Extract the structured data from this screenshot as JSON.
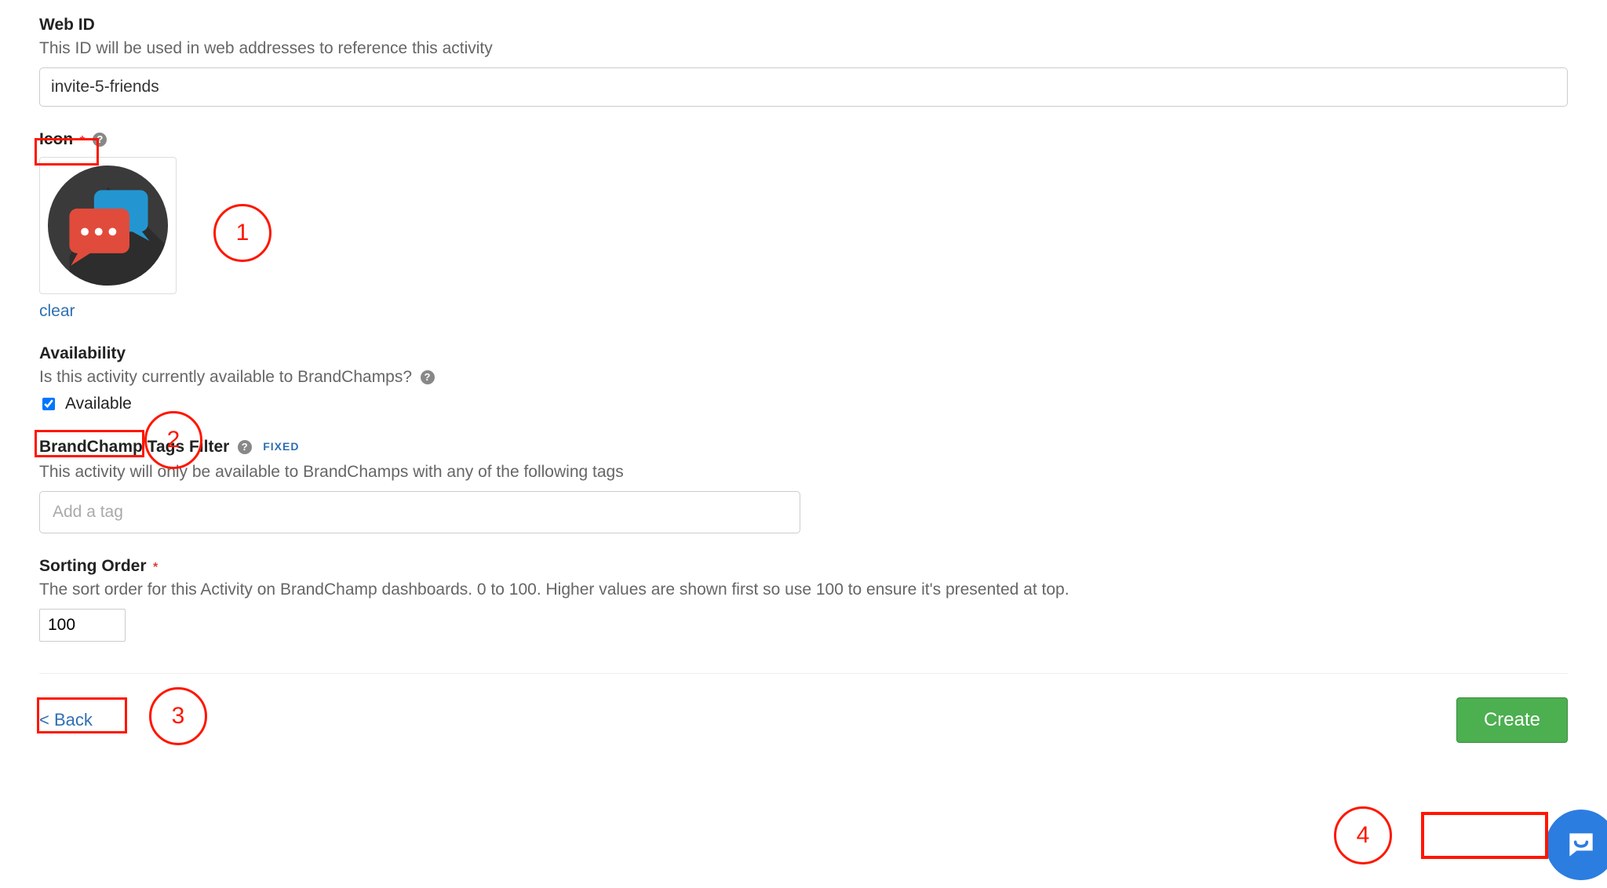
{
  "web_id": {
    "label": "Web ID",
    "help": "This ID will be used in web addresses to reference this activity",
    "value": "invite-5-friends"
  },
  "icon": {
    "label": "Icon",
    "required_marker": "*",
    "clear_text": "clear"
  },
  "availability": {
    "label": "Availability",
    "help": "Is this activity currently available to BrandChamps?",
    "checkbox_label": "Available",
    "checked": true
  },
  "tags": {
    "label": "BrandChamp Tags Filter",
    "badge": "FIXED",
    "help": "This activity will only be available to BrandChamps with any of the following tags",
    "placeholder": "Add a tag"
  },
  "sorting": {
    "label": "Sorting Order",
    "required_marker": "*",
    "help": "The sort order for this Activity on BrandChamp dashboards. 0 to 100. Higher values are shown first so use 100 to ensure it's presented at top.",
    "value": "100"
  },
  "footer": {
    "back": "< Back",
    "create": "Create"
  },
  "annotations": {
    "n1": "1",
    "n2": "2",
    "n3": "3",
    "n4": "4"
  },
  "colors": {
    "accent_green": "#4caf50",
    "link_blue": "#2f6fb3",
    "annotation_red": "#ff1600"
  }
}
